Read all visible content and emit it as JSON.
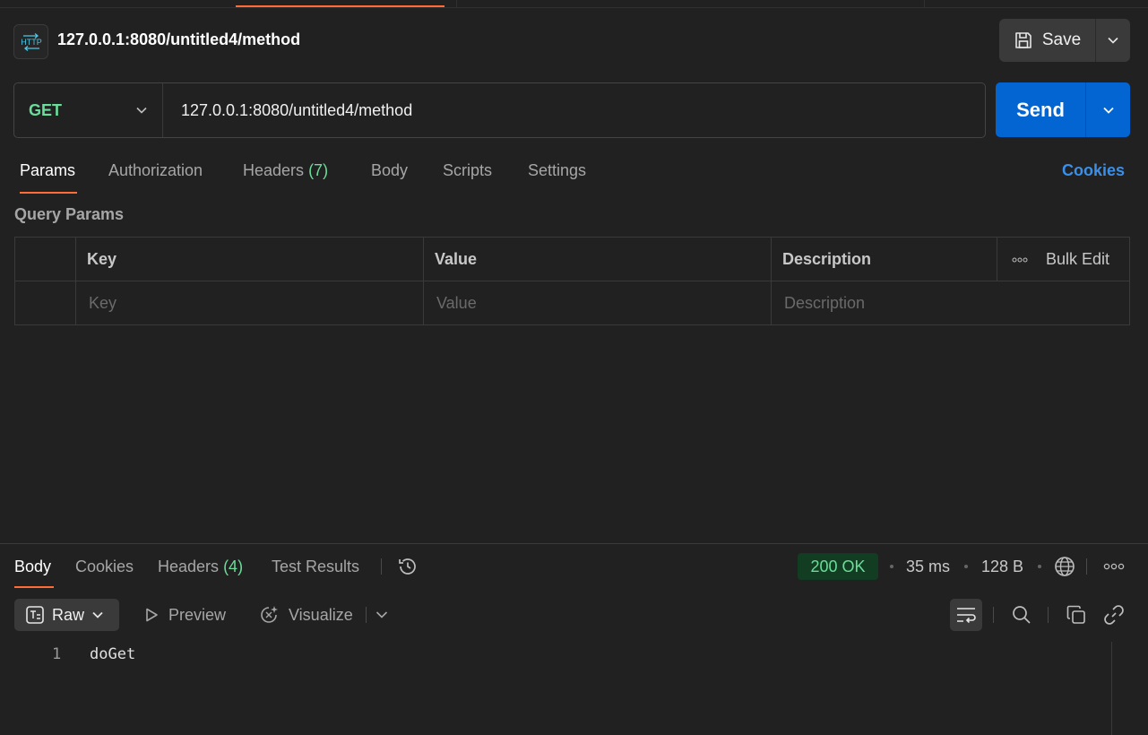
{
  "request": {
    "badge": "HTTP",
    "title": "127.0.0.1:8080/untitled4/method",
    "save_label": "Save",
    "method": "GET",
    "url": "127.0.0.1:8080/untitled4/method",
    "send_label": "Send"
  },
  "request_tabs": {
    "params": "Params",
    "authorization": "Authorization",
    "headers": "Headers",
    "headers_count": "(7)",
    "body": "Body",
    "scripts": "Scripts",
    "settings": "Settings",
    "cookies": "Cookies"
  },
  "query_params": {
    "title": "Query Params",
    "columns": [
      "Key",
      "Value",
      "Description"
    ],
    "bulk_edit": "Bulk Edit",
    "placeholders": [
      "Key",
      "Value",
      "Description"
    ]
  },
  "response_tabs": {
    "body": "Body",
    "cookies": "Cookies",
    "headers": "Headers",
    "headers_count": "(4)",
    "test_results": "Test Results"
  },
  "response_meta": {
    "status": "200 OK",
    "time": "35 ms",
    "size": "128 B"
  },
  "response_toolbar": {
    "format": "Raw",
    "preview": "Preview",
    "visualize": "Visualize"
  },
  "response_body": {
    "lines": [
      {
        "number": "1",
        "text": "doGet"
      }
    ]
  },
  "colors": {
    "accent": "#ff6c37",
    "method_get": "#6bdd9a",
    "send_button": "#0265d2",
    "link": "#3b8fe8",
    "status_ok_bg": "#133d22"
  }
}
